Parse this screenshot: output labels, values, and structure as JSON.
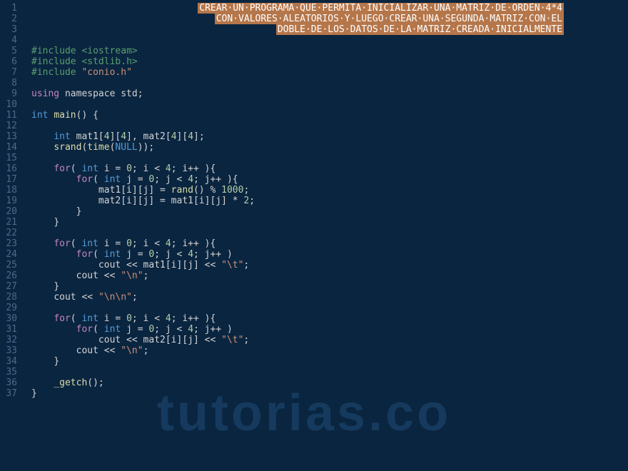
{
  "watermark": "tutorias.co",
  "lines": [
    {
      "n": 1,
      "indent": 0,
      "type": "comment",
      "text": "CREAR·UN·PROGRAMA·QUE·PERMITA·INICIALIZAR·UNA·MATRIZ·DE·ORDEN·4*4",
      "align": "right"
    },
    {
      "n": 2,
      "indent": 0,
      "type": "comment",
      "text": "CON·VALORES·ALEATORIOS·Y·LUEGO·CREAR·UNA·SEGUNDA·MATRIZ·CON·EL",
      "align": "right"
    },
    {
      "n": 3,
      "indent": 0,
      "type": "comment",
      "text": "DOBLE·DE·LOS·DATOS·DE·LA·MATRIZ·CREADA·INICIALMENTE",
      "align": "right"
    },
    {
      "n": 4,
      "indent": 0,
      "type": "blank"
    },
    {
      "n": 5,
      "indent": 0,
      "type": "include",
      "pre": "#include ",
      "lib": "<iostream>",
      "libclass": "str-green"
    },
    {
      "n": 6,
      "indent": 0,
      "type": "include",
      "pre": "#include ",
      "lib": "<stdlib.h>",
      "libclass": "str-green"
    },
    {
      "n": 7,
      "indent": 0,
      "type": "include",
      "pre": "#include ",
      "lib": "\"conio.h\"",
      "libclass": "str"
    },
    {
      "n": 8,
      "indent": 0,
      "type": "blank"
    },
    {
      "n": 9,
      "indent": 0,
      "type": "code",
      "tokens": [
        {
          "t": "using",
          "c": "kw-purple"
        },
        {
          "t": " namespace std;",
          "c": "ident"
        }
      ]
    },
    {
      "n": 10,
      "indent": 0,
      "type": "blank"
    },
    {
      "n": 11,
      "indent": 0,
      "type": "code",
      "tokens": [
        {
          "t": "int",
          "c": "kw-type"
        },
        {
          "t": " ",
          "c": "op"
        },
        {
          "t": "main",
          "c": "kw-func"
        },
        {
          "t": "() {",
          "c": "punct"
        }
      ]
    },
    {
      "n": 12,
      "indent": 0,
      "type": "blank"
    },
    {
      "n": 13,
      "indent": 1,
      "type": "code",
      "tokens": [
        {
          "t": "int",
          "c": "kw-type"
        },
        {
          "t": " mat1[",
          "c": "ident"
        },
        {
          "t": "4",
          "c": "num"
        },
        {
          "t": "][",
          "c": "ident"
        },
        {
          "t": "4",
          "c": "num"
        },
        {
          "t": "], mat2[",
          "c": "ident"
        },
        {
          "t": "4",
          "c": "num"
        },
        {
          "t": "][",
          "c": "ident"
        },
        {
          "t": "4",
          "c": "num"
        },
        {
          "t": "];",
          "c": "ident"
        }
      ]
    },
    {
      "n": 14,
      "indent": 1,
      "type": "code",
      "tokens": [
        {
          "t": "srand",
          "c": "kw-func"
        },
        {
          "t": "(",
          "c": "punct"
        },
        {
          "t": "time",
          "c": "kw-func"
        },
        {
          "t": "(",
          "c": "punct"
        },
        {
          "t": "NULL",
          "c": "kw-null"
        },
        {
          "t": "));",
          "c": "punct"
        }
      ]
    },
    {
      "n": 15,
      "indent": 0,
      "type": "blank"
    },
    {
      "n": 16,
      "indent": 1,
      "type": "code",
      "tokens": [
        {
          "t": "for",
          "c": "kw-purple"
        },
        {
          "t": "( ",
          "c": "punct"
        },
        {
          "t": "int",
          "c": "kw-type"
        },
        {
          "t": " i = ",
          "c": "ident"
        },
        {
          "t": "0",
          "c": "num"
        },
        {
          "t": "; i < ",
          "c": "ident"
        },
        {
          "t": "4",
          "c": "num"
        },
        {
          "t": "; i++ ){",
          "c": "ident"
        }
      ]
    },
    {
      "n": 17,
      "indent": 2,
      "type": "code",
      "tokens": [
        {
          "t": "for",
          "c": "kw-purple"
        },
        {
          "t": "( ",
          "c": "punct"
        },
        {
          "t": "int",
          "c": "kw-type"
        },
        {
          "t": " j = ",
          "c": "ident"
        },
        {
          "t": "0",
          "c": "num"
        },
        {
          "t": "; j < ",
          "c": "ident"
        },
        {
          "t": "4",
          "c": "num"
        },
        {
          "t": "; j++ ){",
          "c": "ident"
        }
      ]
    },
    {
      "n": 18,
      "indent": 3,
      "type": "code",
      "tokens": [
        {
          "t": "mat1[i][j] = ",
          "c": "ident"
        },
        {
          "t": "rand",
          "c": "kw-func"
        },
        {
          "t": "() % ",
          "c": "ident"
        },
        {
          "t": "1000",
          "c": "num"
        },
        {
          "t": ";",
          "c": "punct"
        }
      ]
    },
    {
      "n": 19,
      "indent": 3,
      "type": "code",
      "tokens": [
        {
          "t": "mat2[i][j] = mat1[i][j] * ",
          "c": "ident"
        },
        {
          "t": "2",
          "c": "num"
        },
        {
          "t": ";",
          "c": "punct"
        }
      ]
    },
    {
      "n": 20,
      "indent": 2,
      "type": "code",
      "tokens": [
        {
          "t": "}",
          "c": "punct"
        }
      ]
    },
    {
      "n": 21,
      "indent": 1,
      "type": "code",
      "tokens": [
        {
          "t": "}",
          "c": "punct"
        }
      ]
    },
    {
      "n": 22,
      "indent": 0,
      "type": "blank"
    },
    {
      "n": 23,
      "indent": 1,
      "type": "code",
      "tokens": [
        {
          "t": "for",
          "c": "kw-purple"
        },
        {
          "t": "( ",
          "c": "punct"
        },
        {
          "t": "int",
          "c": "kw-type"
        },
        {
          "t": " i = ",
          "c": "ident"
        },
        {
          "t": "0",
          "c": "num"
        },
        {
          "t": "; i < ",
          "c": "ident"
        },
        {
          "t": "4",
          "c": "num"
        },
        {
          "t": "; i++ ){",
          "c": "ident"
        }
      ]
    },
    {
      "n": 24,
      "indent": 2,
      "type": "code",
      "tokens": [
        {
          "t": "for",
          "c": "kw-purple"
        },
        {
          "t": "( ",
          "c": "punct"
        },
        {
          "t": "int",
          "c": "kw-type"
        },
        {
          "t": " j = ",
          "c": "ident"
        },
        {
          "t": "0",
          "c": "num"
        },
        {
          "t": "; j < ",
          "c": "ident"
        },
        {
          "t": "4",
          "c": "num"
        },
        {
          "t": "; j++ )",
          "c": "ident"
        }
      ]
    },
    {
      "n": 25,
      "indent": 3,
      "type": "code",
      "tokens": [
        {
          "t": "cout << mat1[i][j] << ",
          "c": "ident"
        },
        {
          "t": "\"\\t\"",
          "c": "str"
        },
        {
          "t": ";",
          "c": "punct"
        }
      ]
    },
    {
      "n": 26,
      "indent": 2,
      "type": "code",
      "tokens": [
        {
          "t": "cout << ",
          "c": "ident"
        },
        {
          "t": "\"\\n\"",
          "c": "str"
        },
        {
          "t": ";",
          "c": "punct"
        }
      ]
    },
    {
      "n": 27,
      "indent": 1,
      "type": "code",
      "tokens": [
        {
          "t": "}",
          "c": "punct"
        }
      ]
    },
    {
      "n": 28,
      "indent": 1,
      "type": "code",
      "tokens": [
        {
          "t": "cout << ",
          "c": "ident"
        },
        {
          "t": "\"\\n\\n\"",
          "c": "str"
        },
        {
          "t": ";",
          "c": "punct"
        }
      ]
    },
    {
      "n": 29,
      "indent": 0,
      "type": "blank"
    },
    {
      "n": 30,
      "indent": 1,
      "type": "code",
      "tokens": [
        {
          "t": "for",
          "c": "kw-purple"
        },
        {
          "t": "( ",
          "c": "punct"
        },
        {
          "t": "int",
          "c": "kw-type"
        },
        {
          "t": " i = ",
          "c": "ident"
        },
        {
          "t": "0",
          "c": "num"
        },
        {
          "t": "; i < ",
          "c": "ident"
        },
        {
          "t": "4",
          "c": "num"
        },
        {
          "t": "; i++ ){",
          "c": "ident"
        }
      ]
    },
    {
      "n": 31,
      "indent": 2,
      "type": "code",
      "tokens": [
        {
          "t": "for",
          "c": "kw-purple"
        },
        {
          "t": "( ",
          "c": "punct"
        },
        {
          "t": "int",
          "c": "kw-type"
        },
        {
          "t": " j = ",
          "c": "ident"
        },
        {
          "t": "0",
          "c": "num"
        },
        {
          "t": "; j < ",
          "c": "ident"
        },
        {
          "t": "4",
          "c": "num"
        },
        {
          "t": "; j++ )",
          "c": "ident"
        }
      ]
    },
    {
      "n": 32,
      "indent": 3,
      "type": "code",
      "tokens": [
        {
          "t": "cout << mat2[i][j] << ",
          "c": "ident"
        },
        {
          "t": "\"\\t\"",
          "c": "str"
        },
        {
          "t": ";",
          "c": "punct"
        }
      ]
    },
    {
      "n": 33,
      "indent": 2,
      "type": "code",
      "tokens": [
        {
          "t": "cout << ",
          "c": "ident"
        },
        {
          "t": "\"\\n\"",
          "c": "str"
        },
        {
          "t": ";",
          "c": "punct"
        }
      ]
    },
    {
      "n": 34,
      "indent": 1,
      "type": "code",
      "tokens": [
        {
          "t": "}",
          "c": "punct"
        }
      ]
    },
    {
      "n": 35,
      "indent": 0,
      "type": "blank"
    },
    {
      "n": 36,
      "indent": 1,
      "type": "code",
      "tokens": [
        {
          "t": "_getch",
          "c": "kw-func"
        },
        {
          "t": "();",
          "c": "punct"
        }
      ]
    },
    {
      "n": 37,
      "indent": 0,
      "type": "code",
      "tokens": [
        {
          "t": "}",
          "c": "punct"
        }
      ]
    }
  ]
}
